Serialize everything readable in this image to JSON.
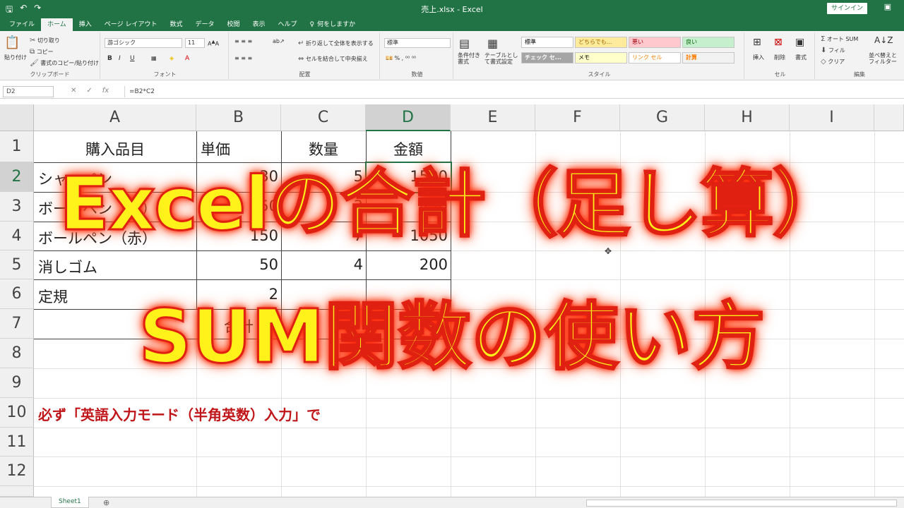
{
  "window": {
    "title": "売上.xlsx  -  Excel",
    "signin": "サインイン"
  },
  "tabs": [
    "ファイル",
    "ホーム",
    "挿入",
    "ページ レイアウト",
    "数式",
    "データ",
    "校閲",
    "表示",
    "ヘルプ"
  ],
  "tell_me": "何をしますか",
  "ribbon": {
    "clipboard": {
      "label": "クリップボード",
      "paste": "貼り付け",
      "cut": "切り取り",
      "copy": "コピー",
      "format_painter": "書式のコピー/貼り付け"
    },
    "font": {
      "label": "フォント",
      "font_name": "游ゴシック",
      "font_size": "11"
    },
    "alignment": {
      "label": "配置",
      "wrap": "折り返して全体を表示する",
      "merge": "セルを結合して中央揃え"
    },
    "number": {
      "label": "数値",
      "format": "標準"
    },
    "styles": {
      "label": "スタイル",
      "conditional": "条件付き書式",
      "table": "テーブルとして書式設定",
      "cells": [
        "標準",
        "どちらでも...",
        "悪い",
        "良い",
        "チェック セ...",
        "メモ",
        "リンク セル",
        "計算"
      ]
    },
    "cells": {
      "label": "セル",
      "insert": "挿入",
      "delete": "削除",
      "format": "書式"
    },
    "editing": {
      "label": "編集",
      "autosum": "オート SUM",
      "fill": "フィル",
      "clear": "クリア",
      "sort": "並べ替えと フィルター"
    }
  },
  "formula_bar": {
    "name_box": "D2",
    "formula": "=B2*C2"
  },
  "columns": [
    "A",
    "B",
    "C",
    "D",
    "E",
    "F",
    "G",
    "H",
    "I"
  ],
  "rows": [
    "1",
    "2",
    "3",
    "4",
    "5",
    "6",
    "7",
    "8",
    "9",
    "10",
    "11",
    "12"
  ],
  "table": {
    "headers": [
      "購入品目",
      "単価",
      "数量",
      "金額"
    ],
    "rows": [
      [
        "シャーペン",
        "30",
        "5",
        "1500"
      ],
      [
        "ボールペン（黒）",
        "150",
        "3",
        "450"
      ],
      [
        "ボールペン（赤）",
        "150",
        "7",
        "1050"
      ],
      [
        "消しゴム",
        "50",
        "4",
        "200"
      ],
      [
        "定規",
        "2",
        "",
        ""
      ]
    ],
    "total_label": "合計"
  },
  "note": "必ず「英語入力モード（半角英数）入力」で",
  "headline": {
    "line1": "Excelの合計（足し算）",
    "line2": "SUM関数の使い方"
  },
  "sheet_tab": "Sheet1",
  "colors": {
    "excel_green": "#217346",
    "headline_fill": "#fff21a",
    "headline_stroke": "#e02010",
    "note_red": "#c0161a"
  }
}
